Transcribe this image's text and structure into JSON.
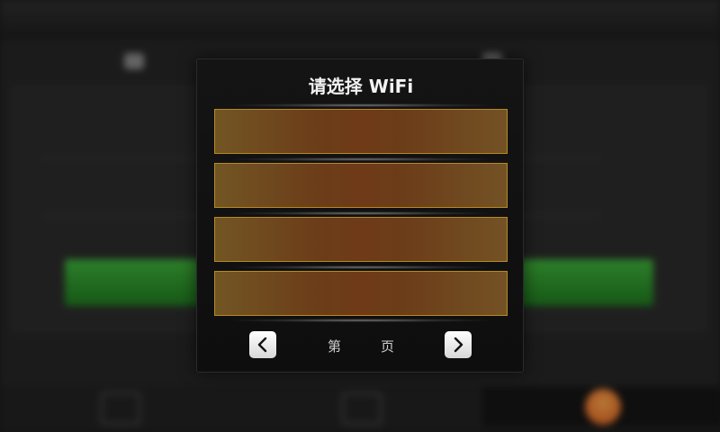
{
  "background": {
    "tabs": [
      {
        "label": "",
        "icon": "wifi-icon"
      },
      {
        "label": "",
        "icon": "user-icon"
      }
    ],
    "fields": [
      {
        "label": "",
        "value": ""
      },
      {
        "label": "",
        "value": ""
      }
    ],
    "buttons": [
      {
        "label": ""
      },
      {
        "label": ""
      }
    ],
    "note": "",
    "bottom_nav": [
      "home-icon",
      "list-icon",
      "wifi-icon"
    ],
    "colors": {
      "button_green": "#2f9a2f",
      "accent_orange": "#f08a2a"
    }
  },
  "dialog": {
    "title": "请选择 WiFi",
    "wifi_slots": [
      {
        "ssid": ""
      },
      {
        "ssid": ""
      },
      {
        "ssid": ""
      },
      {
        "ssid": ""
      }
    ],
    "pagination": {
      "prefix": "第",
      "current": "",
      "suffix": "页",
      "prev_icon": "chevron-left-icon",
      "next_icon": "chevron-right-icon"
    },
    "colors": {
      "slot_border": "#b58a27",
      "slot_fill": "#6c3d19"
    }
  }
}
